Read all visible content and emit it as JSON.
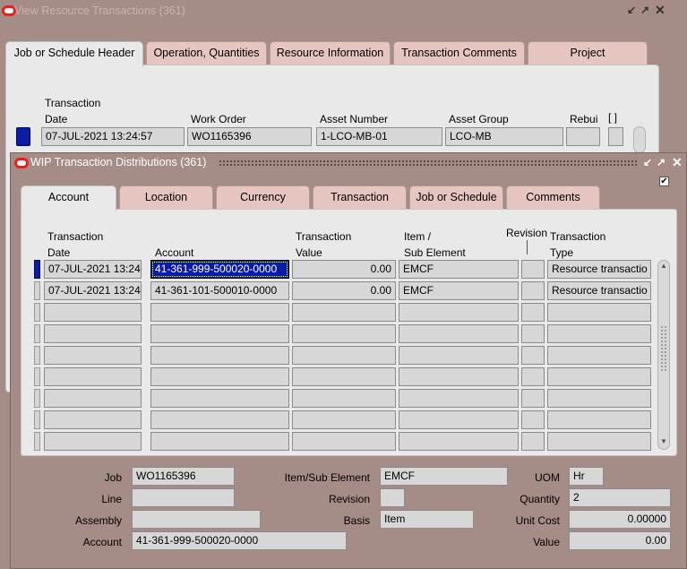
{
  "back_window": {
    "title": "View Resource Transactions (361)",
    "controls": [
      "↙",
      "↗",
      "✕"
    ],
    "tabs": [
      "Job or Schedule Header",
      "Operation, Quantities",
      "Resource Information",
      "Transaction Comments",
      "Project"
    ],
    "headers": {
      "transaction_date_line1": "Transaction",
      "transaction_date_line2": "Date",
      "work_order": "Work Order",
      "asset_number": "Asset Number",
      "asset_group": "Asset Group",
      "rebuild": "Rebui",
      "bracket": "[ ]"
    },
    "row": {
      "transaction_date": "07-JUL-2021 13:24:57",
      "work_order": "WO1165396",
      "asset_number": "1-LCO-MB-01",
      "asset_group": "LCO-MB"
    }
  },
  "front_window": {
    "title": "WIP Transaction Distributions (361)",
    "controls": [
      "↙",
      "↗",
      "✕"
    ],
    "tabs": [
      "Account",
      "Location",
      "Currency",
      "Transaction",
      "Job or Schedule",
      "Comments"
    ],
    "checkbox_mark": "✔",
    "headers": {
      "transaction_date_line1": "Transaction",
      "transaction_date_line2": "Date",
      "account": "Account",
      "transaction_value_line1": "Transaction",
      "transaction_value_line2": "Value",
      "item_line1": "Item /",
      "item_line2": "Sub Element",
      "revision": "Revision",
      "transaction_type_line1": "Transaction",
      "transaction_type_line2": "Type"
    },
    "rows": [
      {
        "date": "07-JUL-2021 13:24",
        "account": "41-361-999-500020-0000",
        "value": "0.00",
        "item": "EMCF",
        "revision": "",
        "type": "Resource transactio"
      },
      {
        "date": "07-JUL-2021 13:24",
        "account": "41-361-101-500010-0000",
        "value": "0.00",
        "item": "EMCF",
        "revision": "",
        "type": "Resource transactio"
      },
      {
        "date": "",
        "account": "",
        "value": "",
        "item": "",
        "revision": "",
        "type": ""
      },
      {
        "date": "",
        "account": "",
        "value": "",
        "item": "",
        "revision": "",
        "type": ""
      },
      {
        "date": "",
        "account": "",
        "value": "",
        "item": "",
        "revision": "",
        "type": ""
      },
      {
        "date": "",
        "account": "",
        "value": "",
        "item": "",
        "revision": "",
        "type": ""
      },
      {
        "date": "",
        "account": "",
        "value": "",
        "item": "",
        "revision": "",
        "type": ""
      },
      {
        "date": "",
        "account": "",
        "value": "",
        "item": "",
        "revision": "",
        "type": ""
      },
      {
        "date": "",
        "account": "",
        "value": "",
        "item": "",
        "revision": "",
        "type": ""
      }
    ],
    "details": {
      "job_label": "Job",
      "job_value": "WO1165396",
      "line_label": "Line",
      "line_value": "",
      "assembly_label": "Assembly",
      "assembly_value": "",
      "account_label": "Account",
      "account_value": "41-361-999-500020-0000",
      "item_label": "Item/Sub Element",
      "item_value": "EMCF",
      "revision_label": "Revision",
      "revision_value": "",
      "basis_label": "Basis",
      "basis_value": "Item",
      "uom_label": "UOM",
      "uom_value": "Hr",
      "quantity_label": "Quantity",
      "quantity_value": "2",
      "unit_cost_label": "Unit Cost",
      "unit_cost_value": "0.00000",
      "value_label": "Value",
      "value_value": "0.00"
    }
  },
  "colors": {
    "desktop": "#a58c86",
    "panel": "#e9e9e9",
    "tab": "#e7c6c2",
    "field": "#d7d7d7",
    "selection": "#0a1ba8",
    "oracle_red": "#e8211a"
  }
}
